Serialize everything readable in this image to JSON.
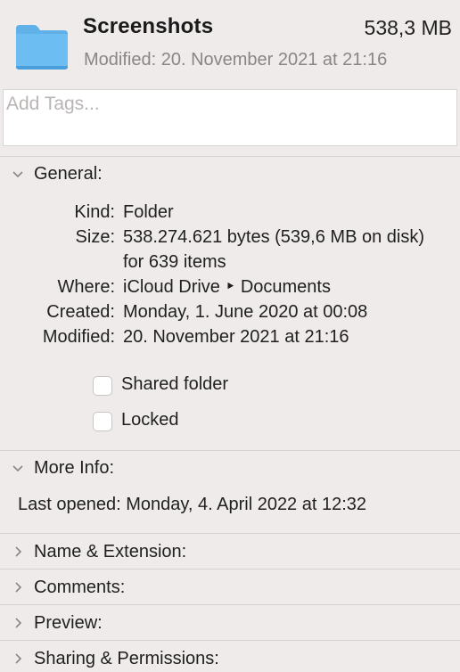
{
  "header": {
    "title": "Screenshots",
    "size": "538,3 MB",
    "modified": "Modified: 20. November 2021 at 21:16",
    "icon": "folder-icon",
    "icon_color": "#5ab0ea"
  },
  "tags": {
    "placeholder": "Add Tags..."
  },
  "general": {
    "label": "General:",
    "expanded": true,
    "rows": [
      {
        "key": "Kind:",
        "value": "Folder"
      },
      {
        "key": "Size:",
        "value": "538.274.621 bytes (539,6 MB on disk) for 639 items"
      },
      {
        "key": "Where:",
        "value": "iCloud Drive ‣ Documents"
      },
      {
        "key": "Created:",
        "value": "Monday, 1. June 2020 at 00:08"
      },
      {
        "key": "Modified:",
        "value": "20. November 2021 at 21:16"
      }
    ],
    "shared_folder_label": "Shared folder",
    "shared_folder_checked": false,
    "locked_label": "Locked",
    "locked_checked": false
  },
  "more_info": {
    "label": "More Info:",
    "expanded": true,
    "last_opened": "Last opened: Monday, 4. April 2022 at 12:32"
  },
  "collapsed_sections": {
    "name_extension": "Name & Extension:",
    "comments": "Comments:",
    "preview": "Preview:",
    "sharing_permissions": "Sharing & Permissions:"
  },
  "colors": {
    "background": "#efebea",
    "secondary_text": "#8a8685",
    "divider": "#d6d2d1"
  }
}
